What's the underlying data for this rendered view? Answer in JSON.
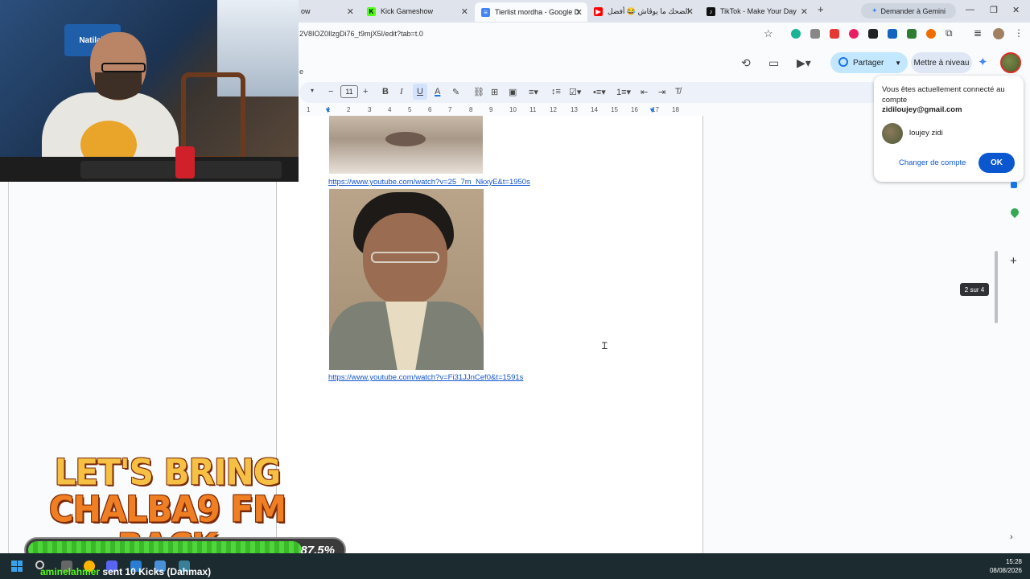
{
  "tabs": [
    {
      "label": "ow",
      "active": false
    },
    {
      "label": "Kick Gameshow",
      "active": false,
      "icon": "kick-icon",
      "icon_color": "#53fc18"
    },
    {
      "label": "Tierlist mordha - Google D",
      "active": true,
      "icon": "docs-icon",
      "icon_color": "#4285f4"
    },
    {
      "label": "الضحك ما يوڨاش 😂 أفضل",
      "active": false,
      "icon": "youtube-icon",
      "icon_color": "#ff0000"
    },
    {
      "label": "TikTok - Make Your Day",
      "active": false,
      "icon": "tiktok-icon",
      "icon_color": "#111111"
    }
  ],
  "gemini_button": "Demander à Gemini",
  "address_bar": {
    "url": "2V8IOZ0IlzgDi76_t9mjX5I/edit?tab=t.0"
  },
  "docs_header": {
    "share_label": "Partager",
    "upgrade_label": "Mettre à niveau"
  },
  "toolbar": {
    "font_size": "11"
  },
  "ruler_ticks": [
    "1",
    "1",
    "2",
    "3",
    "4",
    "5",
    "6",
    "7",
    "8",
    "9",
    "10",
    "11",
    "12",
    "13",
    "14",
    "15",
    "16",
    "17",
    "18"
  ],
  "document": {
    "link1": "https://www.youtube.com/watch?v=25_7m_NkxyE&t=1950s",
    "link2": "https://www.youtube.com/watch?v=Fi31JJnCef0&t=1591s"
  },
  "account_popup": {
    "message": "Vous êtes actuellement connecté au compte",
    "email": "zidiloujey@gmail.com",
    "name": "loujey zidi",
    "switch_label": "Changer de compte",
    "ok_label": "OK"
  },
  "page_counter": "2 sur 4",
  "stream_overlay": {
    "line1": "LET'S BRING",
    "line2": "CHALBA9 FM BACK",
    "progress_percent": 87.5,
    "progress_label": "87.5%",
    "kick_user": "aminelahmer",
    "kick_message": "sent 10 Kicks (Dahmax)"
  },
  "webcam": {
    "banner": "Natilait"
  },
  "clock": {
    "time": "15:28",
    "date": "08/08/2026"
  }
}
